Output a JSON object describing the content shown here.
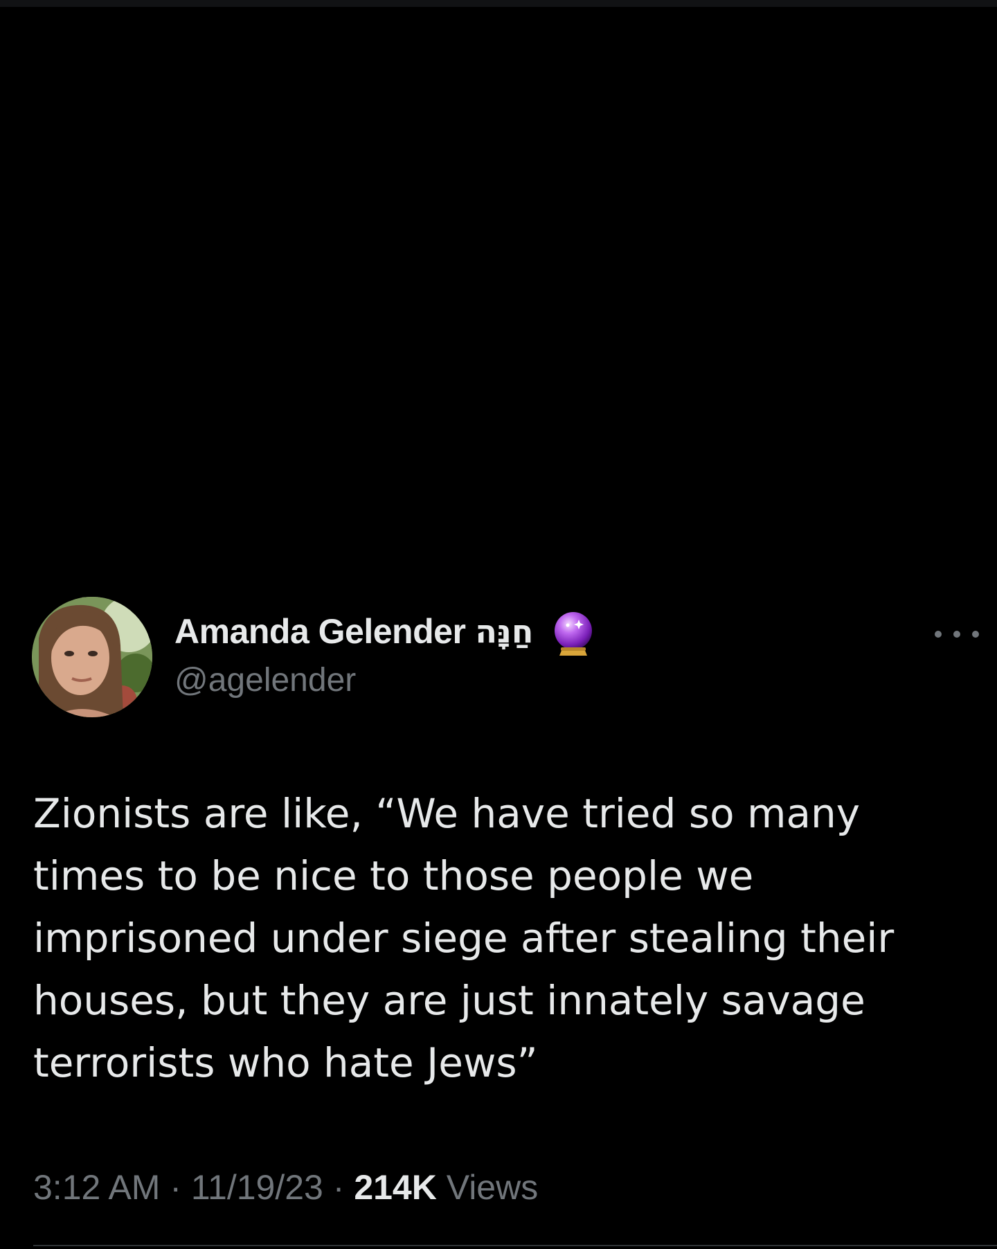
{
  "tweet": {
    "author": {
      "display_name": "Amanda Gelender",
      "hebrew_name": "חַנָּה",
      "badge_icon": "crystal-ball-emoji",
      "handle": "@agelender"
    },
    "more_icon": "more-horizontal-icon",
    "text_lines": [
      "Zionists are like, “We have tried so many",
      "times to be nice to those people we",
      "imprisoned under siege after stealing their",
      "houses, but they are just innately savage",
      "terrorists who hate Jews”"
    ],
    "meta": {
      "time": "3:12 AM",
      "separator": "·",
      "date": "11/19/23",
      "views_count": "214K",
      "views_label": "Views"
    }
  },
  "colors": {
    "background": "#000000",
    "primary_text": "#e7e9ea",
    "secondary_text": "#71767b",
    "divider": "#2f3336",
    "badge_purple": "#9b3fd6"
  }
}
